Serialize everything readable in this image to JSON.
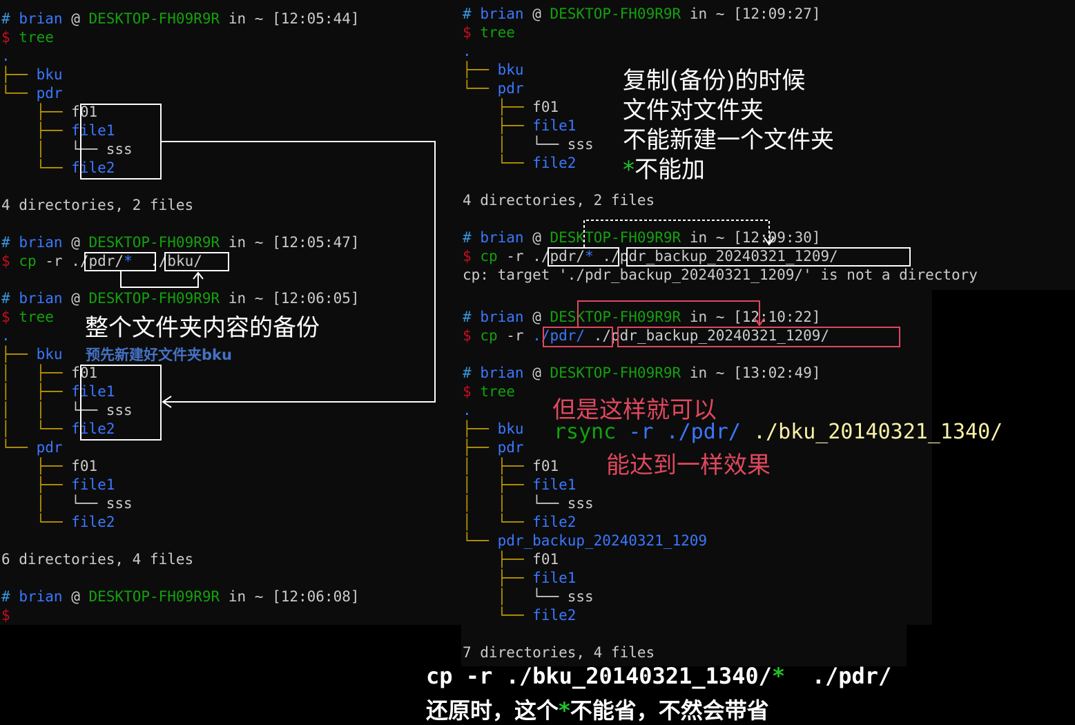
{
  "prompt": {
    "hash": "#",
    "user": "brian",
    "at": "@",
    "host": "DESKTOP-FH09R9R",
    "in": "in",
    "tilde": "~",
    "dollar": "$"
  },
  "left": {
    "p1_time": "[12:05:44]",
    "p1_cmd": "tree",
    "t1": [
      ".",
      "├── bku",
      "└── pdr",
      "f01",
      "file1",
      "└── sss",
      "file2"
    ],
    "t1_branches": [
      "├──",
      "├──",
      "├──",
      "└──"
    ],
    "sum1": "4 directories, 2 files",
    "p2_time": "[12:05:47]",
    "p2_cmd": "cp",
    "p2_flag": "-r",
    "p2_src": "./pdr/",
    "p2_star": "*",
    "p2_dst": "./bku/",
    "p3_time": "[12:06:05]",
    "p3_cmd": "tree",
    "sum2": "6 directories, 4 files",
    "p4_time": "[12:06:08]"
  },
  "right": {
    "p1_time": "[12:09:27]",
    "p1_cmd": "tree",
    "sum1": "4 directories, 2 files",
    "p2_time": "[12:09:30]",
    "p2_cmd": "cp",
    "p2_flag": "-r",
    "p2_src": "./pdr/",
    "p2_star": "*",
    "p2_dst": "./pdr_backup_20240321_1209/",
    "err": "cp: target './pdr_backup_20240321_1209/' is not a directory",
    "p3_time": "[12:10:22]",
    "p3_cmd": "cp",
    "p3_flag": "-r",
    "p3_src": "./pdr/",
    "p3_dst": "./pdr_backup_20240321_1209/",
    "p4_time": "[13:02:49]",
    "p4_cmd": "tree",
    "backup_dir": "pdr_backup_20240321_1209",
    "sum2": "7 directories, 4 files"
  },
  "tree": {
    "dot": ".",
    "bku": "bku",
    "pdr": "pdr",
    "f01": "f01",
    "file1": "file1",
    "sss": "sss",
    "file2": "file2"
  },
  "annotations": {
    "copy_title": "复制(备份)的时候",
    "copy_line2": "文件对文件夹",
    "copy_line3": "不能新建一个文件夹",
    "copy_star": "*",
    "copy_line4": "不能加",
    "whole_folder": "整个文件夹内容的备份",
    "prebuilt": "预先新建好文件夹bku",
    "but_ok": "但是这样就可以",
    "rsync_cmd": "rsync",
    "rsync_flag": "-r",
    "rsync_src": "./pdr/",
    "rsync_dst": "./bku_20140321_1340/",
    "same_effect": "能达到一样效果",
    "restore_cmd": "cp -r ./bku_20140321_1340/",
    "restore_star": "*",
    "restore_dst": "./pdr/",
    "restore_note1": "还原时，这个",
    "restore_star2": "*",
    "restore_note2": "不能省，不然会带省"
  },
  "colors": {
    "background": "#0c0c0c",
    "dir": "#3b78ff",
    "host": "#13a10e",
    "dollar": "#c50f1f",
    "branch": "#c19c00",
    "red_note": "#e0485e",
    "blue_note": "#4472c4"
  }
}
